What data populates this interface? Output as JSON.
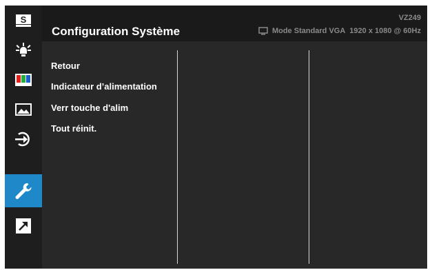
{
  "header": {
    "title": "Configuration Système",
    "model": "VZ249",
    "mode_label": "Mode Standard VGA",
    "resolution": "1920 x 1080 @ 60Hz"
  },
  "sidebar": {
    "items": [
      {
        "name": "splendid",
        "icon": "splendid-s-icon",
        "label": "S"
      },
      {
        "name": "brightness",
        "icon": "brightness-icon"
      },
      {
        "name": "color",
        "icon": "color-bars-icon"
      },
      {
        "name": "image",
        "icon": "image-landscape-icon"
      },
      {
        "name": "input",
        "icon": "input-select-icon"
      },
      {
        "name": "system-setup",
        "icon": "wrench-icon",
        "active": true
      },
      {
        "name": "shortcut",
        "icon": "shortcut-arrow-icon"
      }
    ]
  },
  "menu": {
    "items": [
      "Retour",
      "Indicateur d’alimentation",
      "Verr touche d'alim",
      "Tout réinit."
    ]
  },
  "colors": {
    "accent": "#1e88c8",
    "panel": "#282828",
    "header": "#1a1a1a",
    "sidebar": "#1e1e1e"
  }
}
